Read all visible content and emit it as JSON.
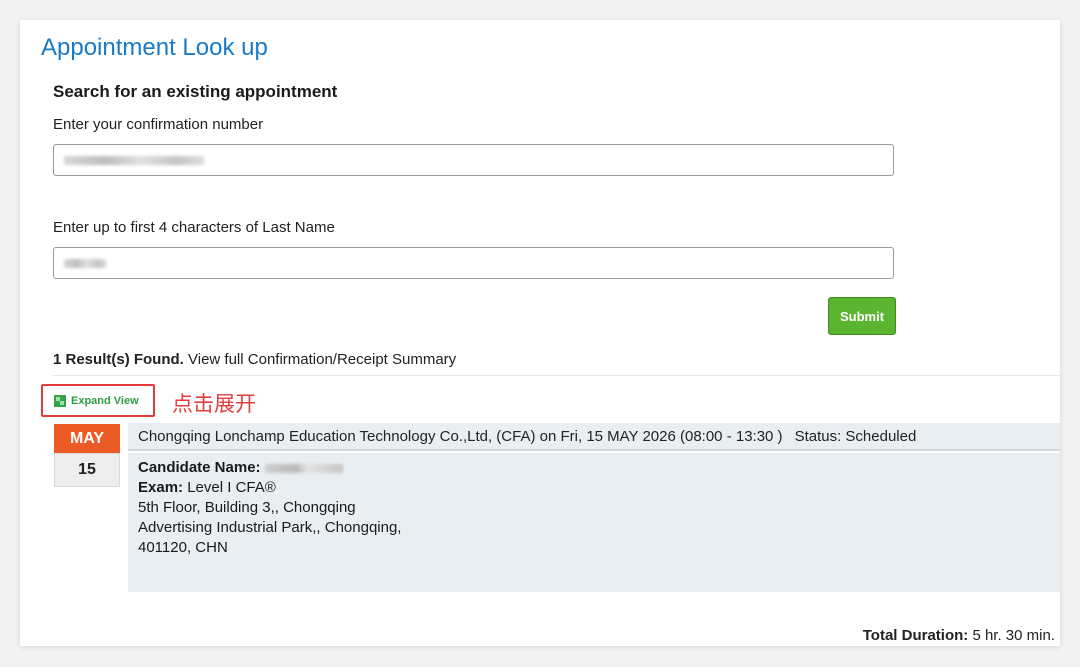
{
  "page": {
    "title": "Appointment Look up",
    "subtitle": "Search for an existing appointment"
  },
  "form": {
    "confirmation_label": "Enter your confirmation number",
    "lastname_label": "Enter up to first 4 characters of Last Name",
    "submit_label": "Submit"
  },
  "results": {
    "count_text": "1 Result(s) Found.",
    "summary_link": "View full Confirmation/Receipt Summary",
    "expand_label": "Expand View",
    "annotation": "点击展开"
  },
  "appointment": {
    "month": "MAY",
    "day": "15",
    "header": "Chongqing Lonchamp Education Technology Co.,Ltd, (CFA) on Fri, 15 MAY 2026 (08:00 - 13:30 )",
    "status": "Status: Scheduled",
    "candidate_label": "Candidate Name:",
    "exam_label": "Exam:",
    "exam_value": "Level I CFA®",
    "address_line1": "5th Floor, Building 3,, Chongqing",
    "address_line2": "Advertising Industrial Park,, Chongqing,",
    "address_line3": "401120, CHN"
  },
  "footer": {
    "total_label": "Total Duration:",
    "total_value": "5 hr. 30 min."
  },
  "colors": {
    "title_blue": "#1a7ac7",
    "submit_green": "#5cb531",
    "month_orange": "#ec5a25",
    "annotation_red": "#e23c3c",
    "expand_green": "#2f9c3e"
  },
  "icons": {
    "expand": "expand-icon"
  }
}
